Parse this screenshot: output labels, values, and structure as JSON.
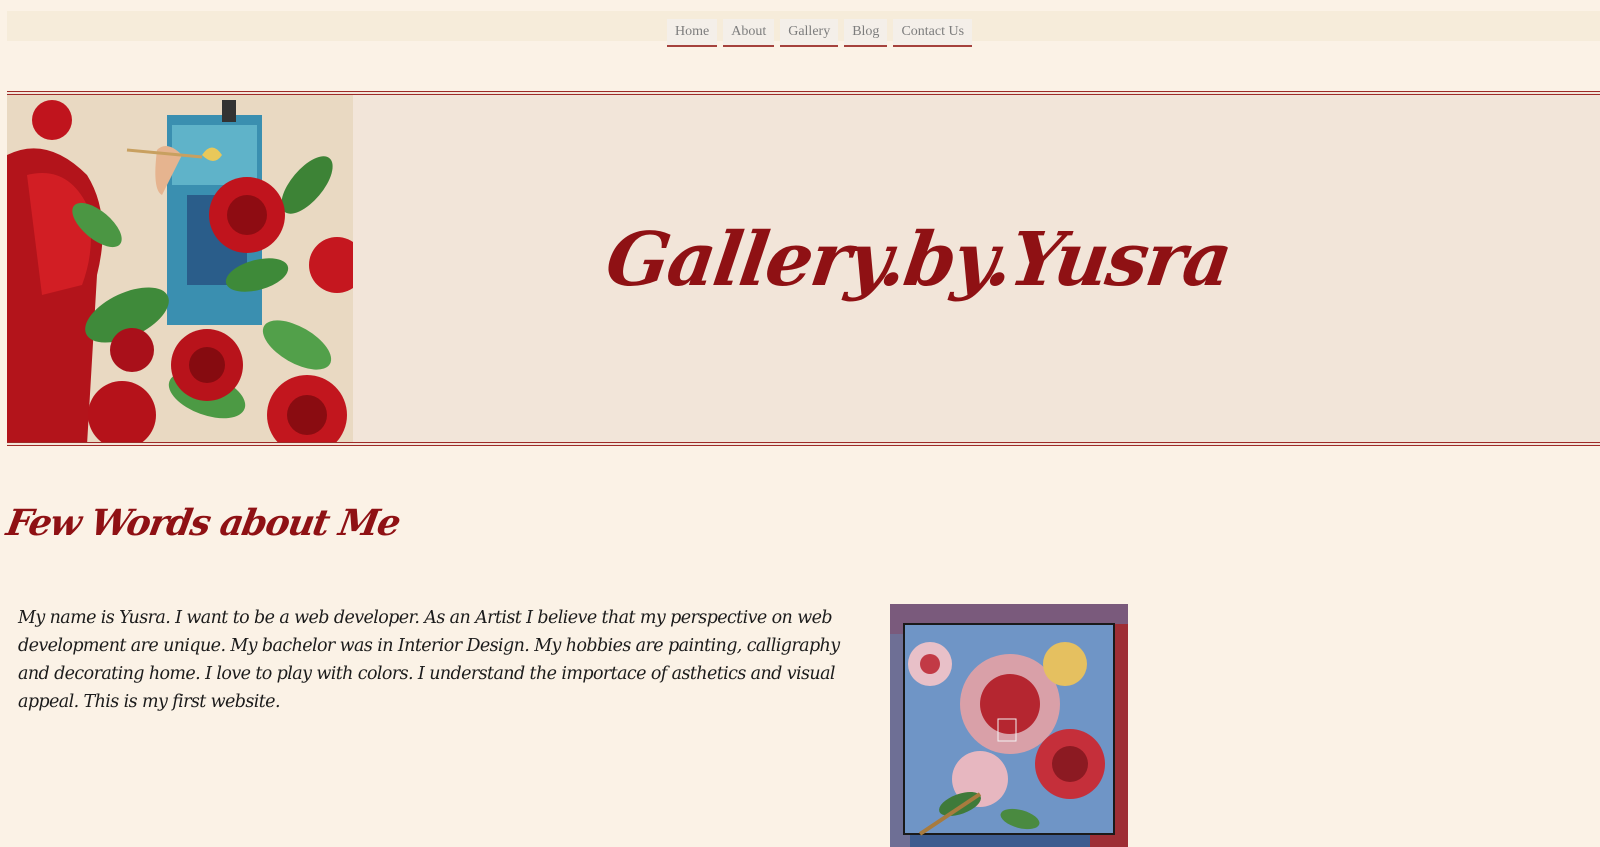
{
  "nav": {
    "items": [
      {
        "label": "Home"
      },
      {
        "label": "About"
      },
      {
        "label": "Gallery"
      },
      {
        "label": "Blog"
      },
      {
        "label": "Contact Us"
      }
    ]
  },
  "hero": {
    "title": "Gallery.by.Yusra"
  },
  "about": {
    "heading": "Few Words about Me",
    "text": "My name is Yusra. I want to be a web developer. As an Artist I believe that my perspective on web development are unique. My bachelor was in Interior Design. My hobbies are painting, calligraphy and decorating home. I love to play with colors. I understand the importace of asthetics and visual appeal. This is my first website."
  },
  "colors": {
    "page_bg": "#fbf2e6",
    "nav_bg": "#f6ecda",
    "hero_bg": "#f2e5d9",
    "accent": "#8f1114",
    "border": "#9e2b28"
  }
}
